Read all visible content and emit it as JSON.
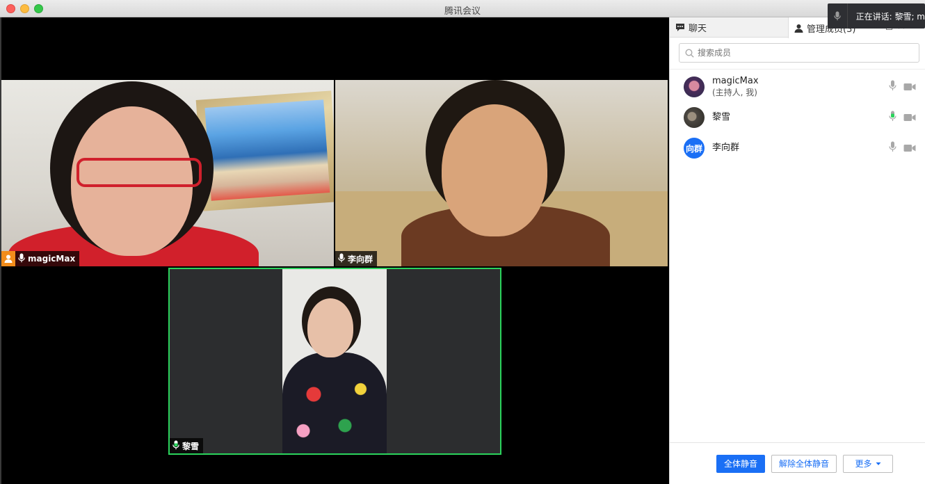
{
  "window": {
    "title": "腾讯会议"
  },
  "toast": {
    "speaking_text": "正在讲话: 黎雪; m"
  },
  "videos": [
    {
      "name": "magicMax",
      "host": true,
      "mic": "on",
      "active_speaker": false
    },
    {
      "name": "李向群",
      "host": false,
      "mic": "on",
      "active_speaker": false
    },
    {
      "name": "黎雪",
      "host": false,
      "mic": "speaking",
      "active_speaker": true
    }
  ],
  "panel": {
    "tab_chat": "聊天",
    "tab_members": "管理成员(3)",
    "search_placeholder": "搜索成员",
    "members": [
      {
        "name": "magicMax",
        "role": "(主持人, 我)",
        "avatar_text": "",
        "mic": "muted-gray",
        "camera": "gray"
      },
      {
        "name": "黎雪",
        "role": "",
        "avatar_text": "",
        "mic": "speaking-green",
        "camera": "gray"
      },
      {
        "name": "李向群",
        "role": "",
        "avatar_text": "向群",
        "mic": "muted-gray",
        "camera": "gray"
      }
    ],
    "buttons": {
      "mute_all": "全体静音",
      "unmute_all": "解除全体静音",
      "more": "更多"
    }
  },
  "colors": {
    "accent": "#1a6ff5",
    "speaking": "#2bd35c",
    "host_badge": "#f28c1b"
  }
}
